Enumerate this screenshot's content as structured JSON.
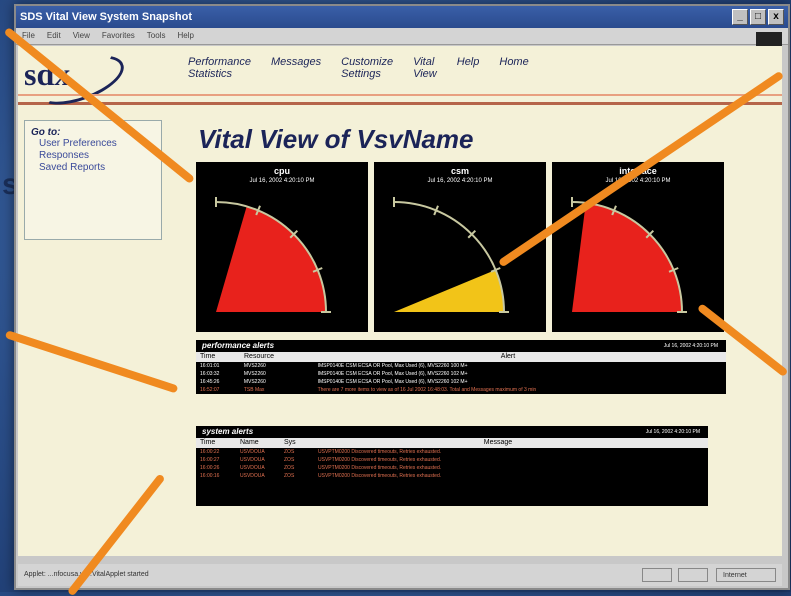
{
  "window": {
    "title": "SDS Vital View System Snapshot",
    "controls": [
      "_",
      "□",
      "x"
    ],
    "menu": [
      "File",
      "Edit",
      "View",
      "Favorites",
      "Tools",
      "Help"
    ]
  },
  "nav": {
    "logo": "sdx",
    "links": [
      {
        "line1": "Performance",
        "line2": "Statistics"
      },
      {
        "line1": "Messages",
        "line2": ""
      },
      {
        "line1": "Customize",
        "line2": "Settings"
      },
      {
        "line1": "Vital",
        "line2": "View"
      },
      {
        "line1": "Help",
        "line2": ""
      },
      {
        "line1": "Home",
        "line2": ""
      }
    ]
  },
  "sidebar": {
    "heading": "Go to:",
    "items": [
      "User Preferences",
      "Responses",
      "Saved Reports"
    ]
  },
  "page_title": "Vital View of VsvName",
  "gauges": [
    {
      "title": "cpu",
      "time": "Jul 16, 2002 4:20:10 PM",
      "level": 0.82,
      "color": "#e8221c"
    },
    {
      "title": "csm",
      "time": "Jul 16, 2002 4:20:10 PM",
      "level": 0.25,
      "color": "#f2c418"
    },
    {
      "title": "interface",
      "time": "Jul 16, 2002 4:20:10 PM",
      "level": 0.92,
      "color": "#e8221c"
    }
  ],
  "performance_alerts": {
    "title": "performance alerts",
    "timestamp": "Jul 16, 2002 4:20:10 PM",
    "columns": [
      "Time",
      "Resource",
      "Alert"
    ],
    "rows": [
      {
        "time": "16:01:01",
        "resource": "MVS2260",
        "alert": "IMSP0140E CSM ECSA OR Pool, Max Used (6), MVS2260 100 M+",
        "red": false
      },
      {
        "time": "16:03:32",
        "resource": "MVS2260",
        "alert": "IMSP0140E CSM ECSA OR Pool, Max Used (6), MVS2260 102 M+",
        "red": false
      },
      {
        "time": "16:45:26",
        "resource": "MVS2260",
        "alert": "IMSP0140E CSM ECSA OR Pool, Max Used (6), MVS2260 102 M+",
        "red": false
      },
      {
        "time": "16:52:07",
        "resource": "TSB Max",
        "alert": "There are 7 more items to view as of 16 Jul 2002 16:48:03. Total and Messages maximum of 3 min",
        "red": true
      }
    ]
  },
  "system_alerts": {
    "title": "system alerts",
    "timestamp": "Jul 16, 2002 4:20:10 PM",
    "columns": [
      "Time",
      "Name",
      "Sys",
      "Message"
    ],
    "rows": [
      {
        "time": "16:00:22",
        "name": "USVDOUA",
        "sys": "ZOS",
        "msg": "USVPTM0200 Discovered timeouts, Retries exhausted."
      },
      {
        "time": "16:00:27",
        "name": "USVDOUA",
        "sys": "ZOS",
        "msg": "USVPTM0200 Discovered timeouts, Retries exhausted."
      },
      {
        "time": "16:00:26",
        "name": "USVDOUA",
        "sys": "ZOS",
        "msg": "USVPTM0200 Discovered timeouts, Retries exhausted."
      },
      {
        "time": "16:00:16",
        "name": "USVDOUA",
        "sys": "ZOS",
        "msg": "USVPTM0200 Discovered timeouts, Retries exhausted."
      }
    ]
  },
  "status": {
    "message": "Applet: ...nfocusa.vsv.VitalApplet started",
    "zone": "Internet"
  },
  "colors": {
    "accent": "#f08a20",
    "nav": "#1b2458"
  }
}
